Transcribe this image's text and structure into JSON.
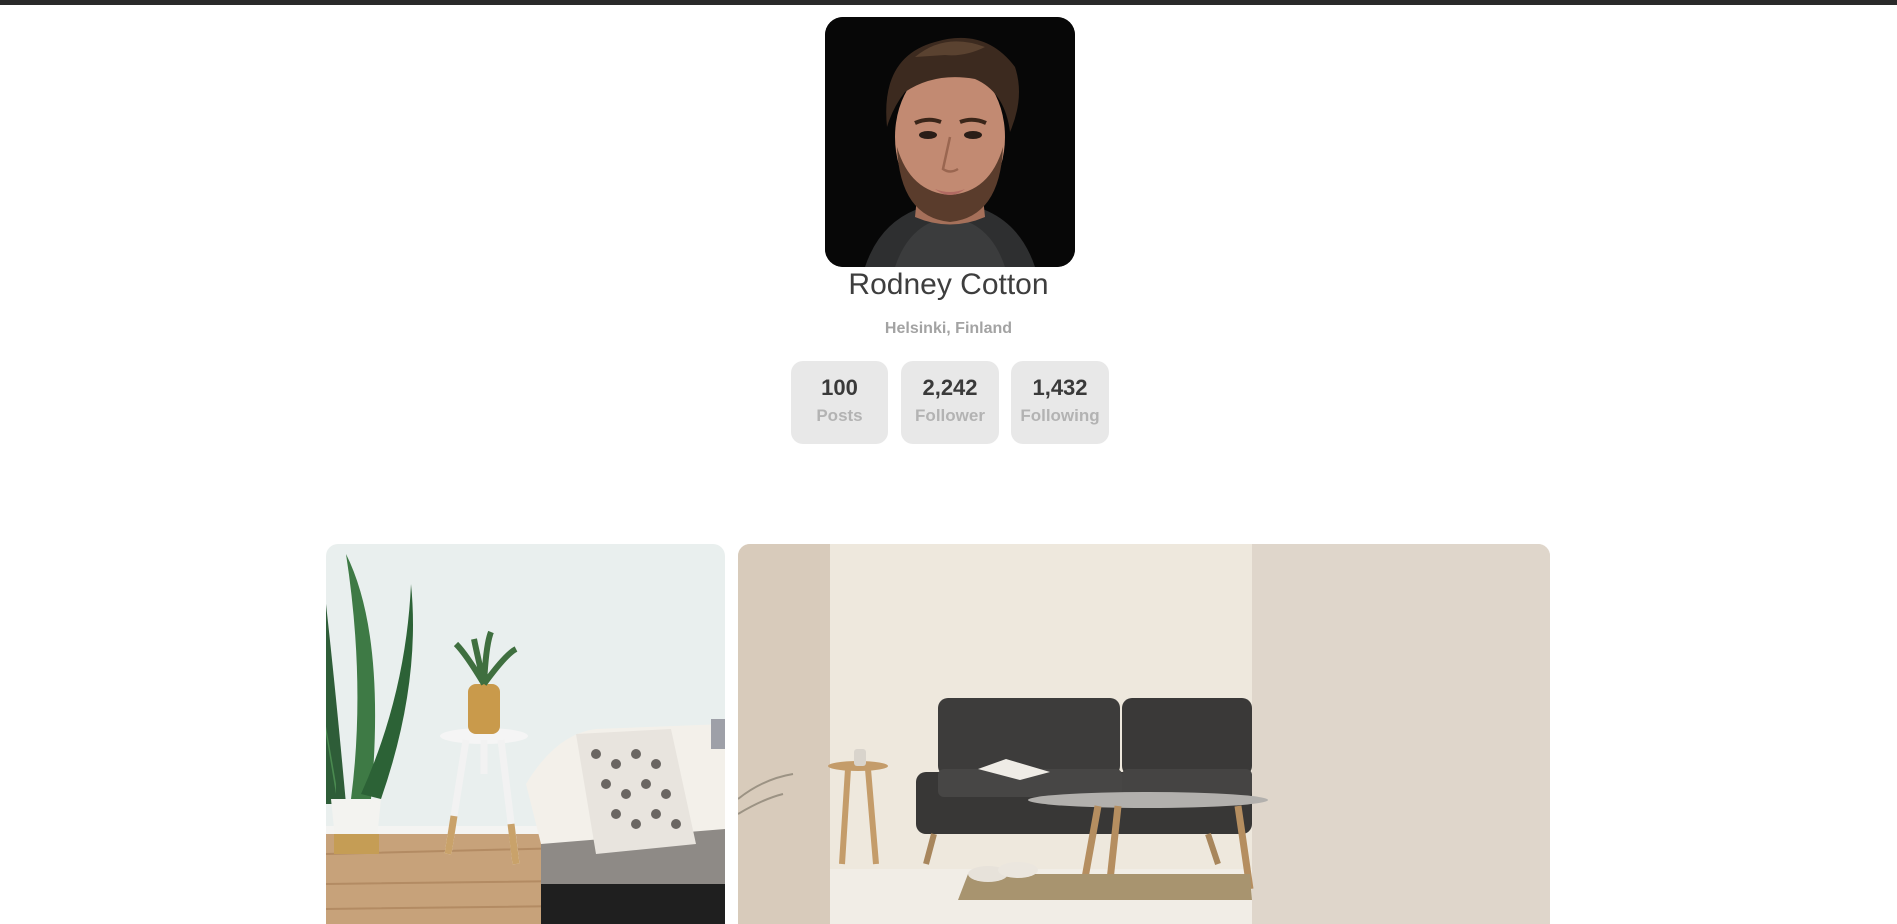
{
  "profile": {
    "name": "Rodney Cotton",
    "location": "Helsinki, Finland",
    "avatar_alt": "profile-photo"
  },
  "stats": [
    {
      "value": "100",
      "label": "Posts"
    },
    {
      "value": "2,242",
      "label": "Follower"
    },
    {
      "value": "1,432",
      "label": "Following"
    }
  ],
  "gallery": [
    {
      "name": "living-room-plant-photo"
    },
    {
      "name": "grey-sofa-photo"
    }
  ],
  "colors": {
    "top_bar": "#2a2a2a",
    "name_text": "#3e3e3e",
    "muted_text": "#a3a3a3",
    "stat_bg": "#e8e8e8"
  }
}
